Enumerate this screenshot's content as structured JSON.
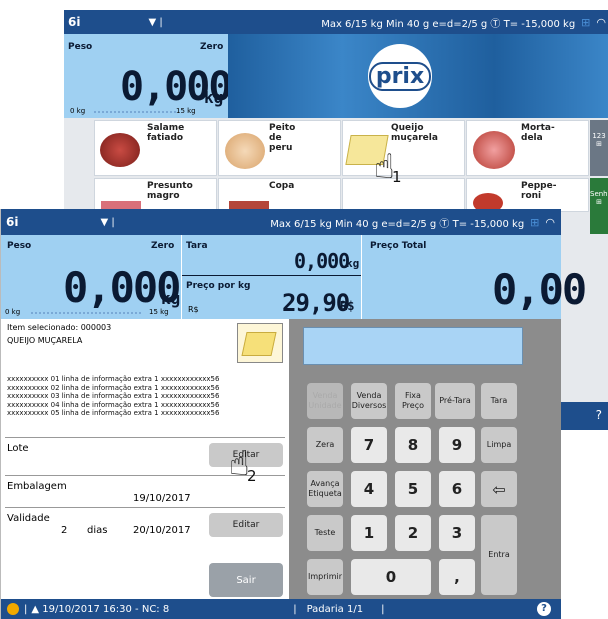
{
  "back_screen": {
    "topbar": {
      "app": "6i",
      "status": "Max 6/15 kg Min 40 g e=d=2/5 g  Ⓣ T= -15,000 kg"
    },
    "weight": {
      "label": "Peso",
      "zero_label": "Zero",
      "value": "0,000",
      "unit": "kg",
      "scale_min": "0 kg",
      "scale_max": "15 kg"
    },
    "logo": "prix",
    "products": [
      {
        "name": "Salame fatiado"
      },
      {
        "name": "Peito de peru"
      },
      {
        "name": "Queijo muçarela"
      },
      {
        "name": "Morta-dela"
      },
      {
        "name": "Presunto magro"
      },
      {
        "name": "Copa"
      },
      {
        "name": "Peppe-roni"
      }
    ],
    "side_tabs": [
      "123",
      "Senha"
    ],
    "step1": "1"
  },
  "front_screen": {
    "topbar": {
      "app": "6i",
      "status": "Max 6/15 kg Min 40 g e=d=2/5 g  Ⓣ T= -15,000 kg"
    },
    "weight": {
      "label": "Peso",
      "zero_label": "Zero",
      "value": "0,000",
      "unit": "kg",
      "scale_min": "0 kg",
      "scale_max": "15 kg"
    },
    "tara": {
      "label": "Tara",
      "value": "0,000",
      "unit": "kg"
    },
    "price_per_kg": {
      "label": "Preço por kg",
      "currency": "R$",
      "value": "29,90",
      "unit": "R$"
    },
    "total": {
      "label": "Preço Total",
      "value": "0,00"
    },
    "item": {
      "selected": "Item selecionado: 000003",
      "name": "QUEIJO MUÇARELA",
      "lines": [
        "xxxxxxxxxx 01 linha de informação extra 1 xxxxxxxxxxxx56",
        "xxxxxxxxxx 02 linha de informação extra 1 xxxxxxxxxxxx56",
        "xxxxxxxxxx 03 linha de informação extra 1 xxxxxxxxxxxx56",
        "xxxxxxxxxx 04 linha de informação extra 1 xxxxxxxxxxxx56",
        "xxxxxxxxxx 05 linha de informação extra 1 xxxxxxxxxxxx56"
      ]
    },
    "lote": {
      "label": "Lote",
      "button": "Editar"
    },
    "embalagem": {
      "label": "Embalagem",
      "date": "19/10/2017"
    },
    "validade": {
      "label": "Validade",
      "days": "2",
      "days_unit": "dias",
      "date": "20/10/2017",
      "button": "Editar"
    },
    "sair": "Sair",
    "step2": "2",
    "keypad": {
      "venda_unidade": "Venda Unidade",
      "venda_diversos": "Venda Diversos",
      "fixa_preco": "Fixa Preço",
      "pre_tara": "Pré-Tara",
      "tara": "Tara",
      "zera": "Zera",
      "limpa": "Limpa",
      "avanca": "Avança Etiqueta",
      "teste": "Teste",
      "imprimir": "Imprimir",
      "entra": "Entra",
      "k7": "7",
      "k8": "8",
      "k9": "9",
      "k4": "4",
      "k5": "5",
      "k6": "6",
      "k1": "1",
      "k2": "2",
      "k3": "3",
      "k0": "0",
      "comma": ","
    },
    "bottombar": {
      "datetime": "▲ 19/10/2017 16:30 - NC: 8",
      "section": "Padaria 1/1"
    }
  }
}
